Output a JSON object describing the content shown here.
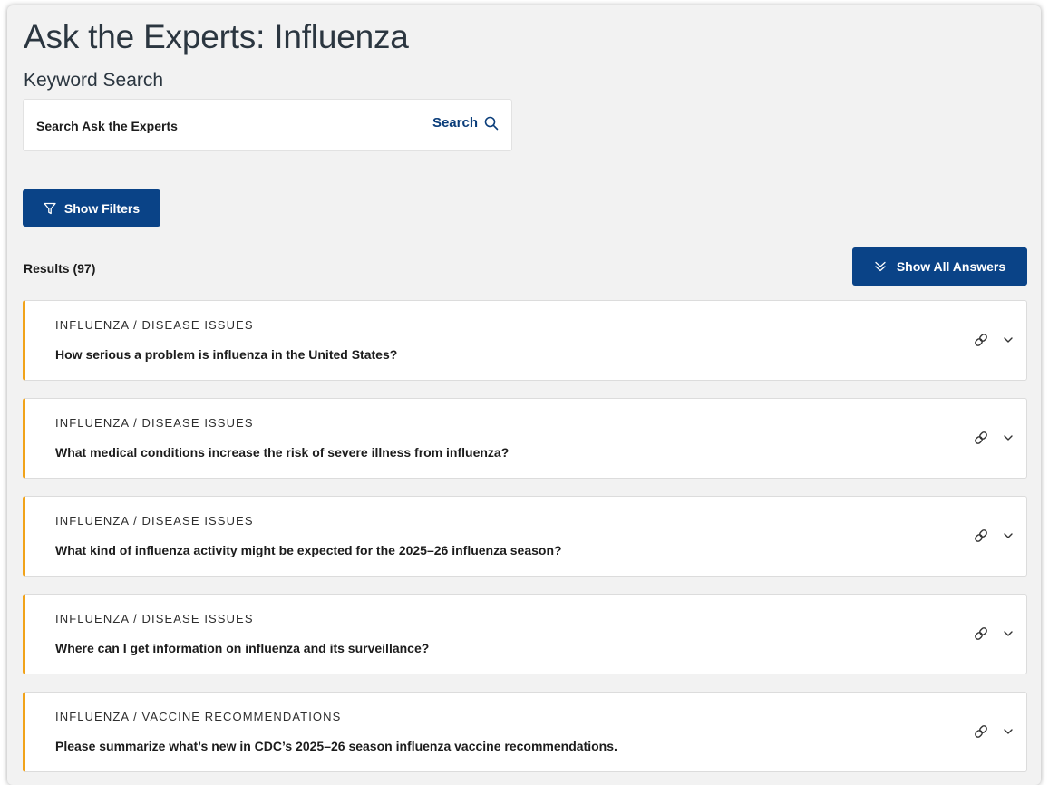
{
  "page": {
    "title": "Ask the Experts: Influenza",
    "subtitle": "Keyword Search"
  },
  "search": {
    "placeholder": "Search Ask the Experts",
    "value": "",
    "button_label": "Search",
    "icon": "search-icon"
  },
  "filters": {
    "button_label": "Show Filters",
    "icon": "filter-icon"
  },
  "results": {
    "count_label": "Results (97)",
    "show_all_label": "Show All Answers",
    "show_all_icon": "double-chevron-down-icon",
    "items": [
      {
        "category": "INFLUENZA / DISEASE ISSUES",
        "question": "How serious a problem is influenza in the United States?"
      },
      {
        "category": "INFLUENZA / DISEASE ISSUES",
        "question": "What medical conditions increase the risk of severe illness from influenza?"
      },
      {
        "category": "INFLUENZA / DISEASE ISSUES",
        "question": "What kind of influenza activity might be expected for the 2025–26 influenza season?"
      },
      {
        "category": "INFLUENZA / DISEASE ISSUES",
        "question": "Where can I get information on influenza and its surveillance?"
      },
      {
        "category": "INFLUENZA / VACCINE RECOMMENDATIONS",
        "question": "Please summarize what’s new in CDC’s 2025–26 season influenza vaccine recommendations."
      }
    ]
  },
  "colors": {
    "primary_button": "#0a4387",
    "link_text": "#0a3d7a",
    "card_accent": "#f1a31a",
    "background": "#f2f2f2",
    "heading_text": "#2b3640"
  }
}
